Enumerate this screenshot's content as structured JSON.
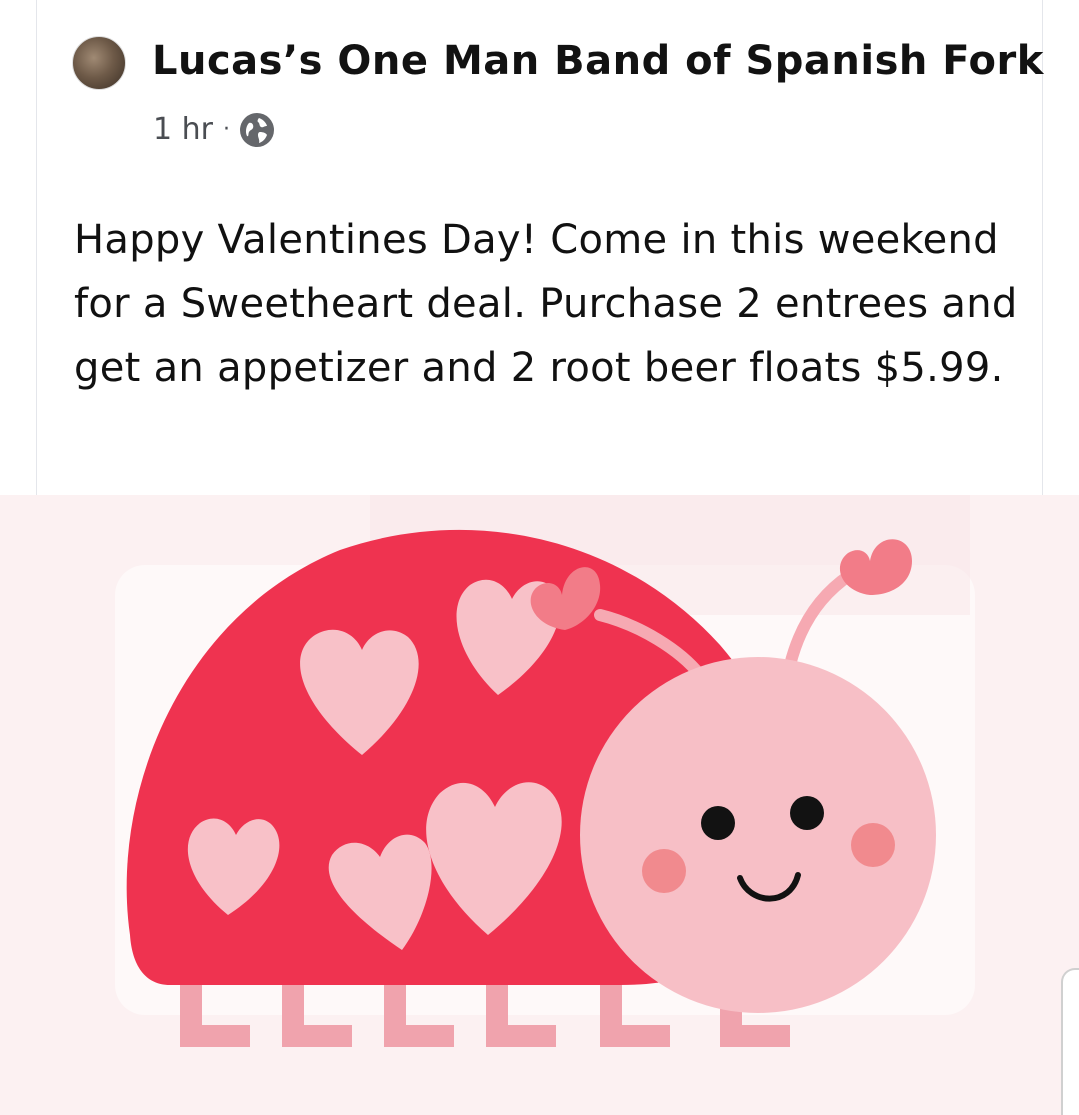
{
  "post": {
    "author": "Lucas’s One Man Band of Spanish Fork",
    "timestamp": "1 hr",
    "separator": "·",
    "privacy_icon": "globe-icon",
    "text": "Happy Valentines Day! Come in this weekend for a Sweetheart deal. Purchase 2 entrees and get an appetizer and 2 root beer floats $5.99."
  },
  "image": {
    "description_icon": "ladybug-hearts-illustration",
    "colors": {
      "shell": "#ef3350",
      "hearts": "#f8c1c8",
      "head": "#f7bfc6",
      "cheeks": "#f18a8e",
      "background": "#fcf1f2"
    }
  }
}
